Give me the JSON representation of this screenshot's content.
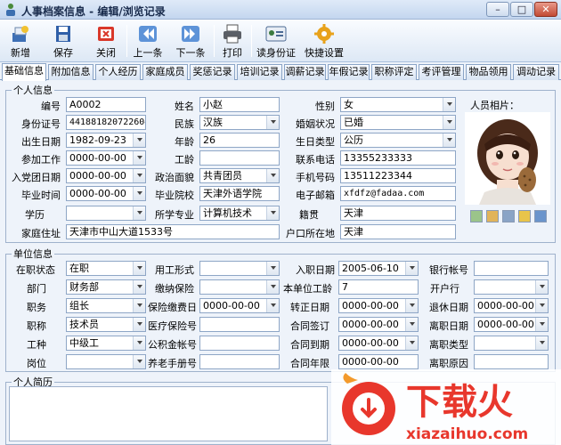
{
  "window": {
    "title": "人事档案信息 - 编辑/浏览记录",
    "min": "–",
    "max": "□",
    "close": "✕"
  },
  "toolbar": {
    "new": "新增",
    "save": "保存",
    "close": "关闭",
    "prev": "上一条",
    "next": "下一条",
    "print": "打印",
    "read_id": "读身份证",
    "quick_settings": "快捷设置"
  },
  "tabs": [
    "基础信息",
    "附加信息",
    "个人经历",
    "家庭成员",
    "奖惩记录",
    "培训记录",
    "调薪记录",
    "年假记录",
    "职称评定",
    "考评管理",
    "物品领用",
    "调动记录"
  ],
  "personal": {
    "legend": "个人信息",
    "labels": {
      "id": "编号",
      "name": "姓名",
      "gender": "性别",
      "idcard": "身份证号",
      "ethnicity": "民族",
      "marital": "婚姻状况",
      "birth_date": "出生日期",
      "age": "年龄",
      "birthday_type": "生日类型",
      "work_start": "参加工作",
      "seniority": "工龄",
      "phone": "联系电话",
      "party_date": "入党团日期",
      "politics": "政治面貌",
      "mobile": "手机号码",
      "graduation": "毕业时间",
      "school": "毕业院校",
      "email": "电子邮箱",
      "education": "学历",
      "major": "所学专业",
      "native": "籍贯",
      "address": "家庭住址",
      "hukou": "户口所在地"
    },
    "values": {
      "id": "A0002",
      "name": "小赵",
      "gender": "女",
      "idcard": "441881820722604",
      "ethnicity": "汉族",
      "marital": "已婚",
      "birth_date": "1982-09-23",
      "age": "26",
      "birthday_type": "公历",
      "work_start": "0000-00-00",
      "seniority": "",
      "phone": "13355233333",
      "party_date": "0000-00-00",
      "politics": "共青团员",
      "mobile": "13511223344",
      "graduation": "0000-00-00",
      "school": "天津外语学院",
      "email": "xfdfz@fadaa.com",
      "education": "",
      "major": "计算机技术",
      "native": "天津",
      "address": "天津市中山大道1533号",
      "hukou": "天津"
    },
    "photo_label": "人员相片："
  },
  "unit": {
    "legend": "单位信息",
    "labels": {
      "status": "在职状态",
      "employment": "用工形式",
      "hire_date": "入职日期",
      "bank_account": "银行帐号",
      "dept": "部门",
      "insurance": "缴纳保险",
      "unit_seniority": "本单位工龄",
      "bank": "开户行",
      "position": "职务",
      "insurance_date": "保险缴费日",
      "regular_date": "转正日期",
      "retire_date": "退休日期",
      "title": "职称",
      "medical_no": "医疗保险号",
      "contract_sign": "合同签订",
      "leave_date": "离职日期",
      "grade": "工种",
      "fund_no": "公积金帐号",
      "contract_expire": "合同到期",
      "leave_type": "离职类型",
      "post": "岗位",
      "pension_no": "养老手册号",
      "contract_years": "合同年限",
      "leave_reason": "离职原因"
    },
    "values": {
      "status": "在职",
      "employment": "",
      "hire_date": "2005-06-10",
      "bank_account": "",
      "dept": "财务部",
      "insurance": "",
      "unit_seniority": "7",
      "bank": "",
      "position": "组长",
      "insurance_date": "0000-00-00",
      "regular_date": "0000-00-00",
      "retire_date": "0000-00-00",
      "title": "技术员",
      "medical_no": "",
      "contract_sign": "0000-00-00",
      "leave_date": "0000-00-00",
      "grade": "中级工",
      "fund_no": "",
      "contract_expire": "0000-00-00",
      "leave_type": "",
      "post": "",
      "pension_no": "",
      "contract_years": "0000-00-00",
      "leave_reason": ""
    }
  },
  "resume": {
    "legend": "个人简历",
    "text": ""
  },
  "watermark": {
    "text": "下载火",
    "url": "xiazaihuo.com"
  }
}
